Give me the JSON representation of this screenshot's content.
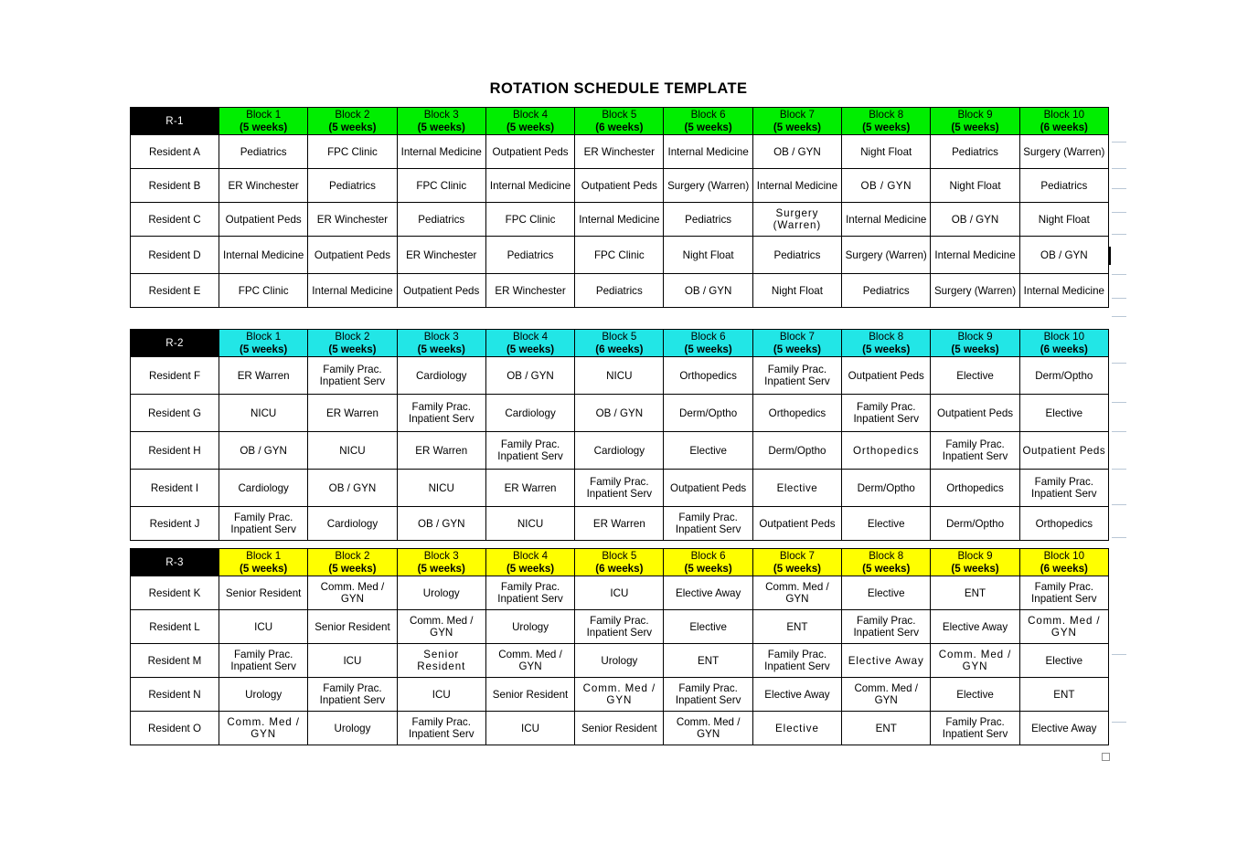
{
  "document": {
    "title": "ROTATION SCHEDULE TEMPLATE"
  },
  "blocks": {
    "headers": [
      {
        "name": "Block 1",
        "weeks": "(5 weeks)"
      },
      {
        "name": "Block 2",
        "weeks": "(5 weeks)"
      },
      {
        "name": "Block 3",
        "weeks": "(5 weeks)"
      },
      {
        "name": "Block 4",
        "weeks": "(5 weeks)"
      },
      {
        "name": "Block 5",
        "weeks": "(6 weeks)"
      },
      {
        "name": "Block 6",
        "weeks": "(5 weeks)"
      },
      {
        "name": "Block 7",
        "weeks": "(5 weeks)"
      },
      {
        "name": "Block 8",
        "weeks": "(5 weeks)"
      },
      {
        "name": "Block 9",
        "weeks": "(5 weeks)"
      },
      {
        "name": "Block 10",
        "weeks": "(6 weeks)"
      }
    ]
  },
  "colors": {
    "r1_header": "#00EE00",
    "r2_header": "#22E6E6",
    "r3_header": "#FFFF00",
    "year_cell": "#000000",
    "text": "#000000"
  },
  "r1": {
    "year_label": "R-1",
    "headers": [
      {
        "name": "Block 1",
        "weeks": "(5 weeks)"
      },
      {
        "name": "Block 2",
        "weeks": "(5 weeks)"
      },
      {
        "name": "Block 3",
        "weeks": "(5 weeks)"
      },
      {
        "name": "Block 4",
        "weeks": "(5 weeks)"
      },
      {
        "name": "Block 5",
        "weeks": "(6 weeks)"
      },
      {
        "name": "Block 6",
        "weeks": "(5 weeks)"
      },
      {
        "name": "Block 7",
        "weeks": "(5 weeks)"
      },
      {
        "name": "Block 8",
        "weeks": "(5 weeks)"
      },
      {
        "name": "Block 9",
        "weeks": "(5 weeks)"
      },
      {
        "name": "Block 10",
        "weeks": "(6 weeks)"
      }
    ],
    "rows": [
      {
        "resident": "Resident A",
        "cells": [
          "Pediatrics",
          "FPC Clinic",
          "Internal Medicine",
          "Outpatient Peds",
          "ER Winchester",
          "Internal Medicine",
          "OB / GYN",
          "Night Float",
          "Pediatrics",
          "Surgery (Warren)"
        ]
      },
      {
        "resident": "Resident B",
        "cells": [
          "ER Winchester",
          "Pediatrics",
          "FPC Clinic",
          "Internal Medicine",
          "Outpatient Peds",
          "Surgery (Warren)",
          "Internal Medicine",
          "OB / GYN",
          "Night Float",
          "Pediatrics"
        ]
      },
      {
        "resident": "Resident C",
        "cells": [
          "Outpatient Peds",
          "ER Winchester",
          "Pediatrics",
          "FPC Clinic",
          "Internal Medicine",
          "Pediatrics",
          "Surgery (Warren)",
          "Internal Medicine",
          "OB / GYN",
          "Night Float"
        ]
      },
      {
        "resident": "Resident D",
        "cells": [
          "Internal Medicine",
          "Outpatient Peds",
          "ER Winchester",
          "Pediatrics",
          "FPC Clinic",
          "Night Float",
          "Pediatrics",
          "Surgery (Warren)",
          "Internal Medicine",
          "OB / GYN"
        ]
      },
      {
        "resident": "Resident E",
        "cells": [
          "FPC Clinic",
          "Internal Medicine",
          "Outpatient Peds",
          "ER Winchester",
          "Pediatrics",
          "OB / GYN",
          "Night Float",
          "Pediatrics",
          "Surgery (Warren)",
          "Internal Medicine"
        ]
      }
    ]
  },
  "r2": {
    "year_label": "R-2",
    "headers": [
      {
        "name": "Block 1",
        "weeks": "(5 weeks)"
      },
      {
        "name": "Block 2",
        "weeks": "(5 weeks)"
      },
      {
        "name": "Block 3",
        "weeks": "(5 weeks)"
      },
      {
        "name": "Block 4",
        "weeks": "(5 weeks)"
      },
      {
        "name": "Block 5",
        "weeks": "(6 weeks)"
      },
      {
        "name": "Block 6",
        "weeks": "(5 weeks)"
      },
      {
        "name": "Block 7",
        "weeks": "(5 weeks)"
      },
      {
        "name": "Block 8",
        "weeks": "(5 weeks)"
      },
      {
        "name": "Block 9",
        "weeks": "(5 weeks)"
      },
      {
        "name": "Block 10",
        "weeks": "(6 weeks)"
      }
    ],
    "rows": [
      {
        "resident": "Resident F",
        "cells": [
          "ER  Warren",
          "Family Prac. Inpatient Serv",
          "Cardiology",
          "OB / GYN",
          "NICU",
          "Orthopedics",
          "Family Prac. Inpatient Serv",
          "Outpatient Peds",
          "Elective",
          "Derm/Optho"
        ]
      },
      {
        "resident": "Resident G",
        "cells": [
          "NICU",
          "ER Warren",
          "Family Prac. Inpatient Serv",
          "Cardiology",
          "OB / GYN",
          "Derm/Optho",
          "Orthopedics",
          "Family Prac. Inpatient Serv",
          "Outpatient Peds",
          "Elective"
        ]
      },
      {
        "resident": "Resident H",
        "cells": [
          "OB / GYN",
          "NICU",
          "ER Warren",
          "Family Prac. Inpatient Serv",
          "Cardiology",
          "Elective",
          "Derm/Optho",
          "Orthopedics",
          "Family Prac. Inpatient Serv",
          "Outpatient Peds"
        ]
      },
      {
        "resident": "Resident I",
        "cells": [
          "Cardiology",
          "OB / GYN",
          "NICU",
          "ER  Warren",
          "Family Prac. Inpatient Serv",
          "Outpatient Peds",
          "Elective",
          "Derm/Optho",
          "Orthopedics",
          "Family Prac. Inpatient Serv"
        ]
      },
      {
        "resident": "Resident J",
        "cells": [
          "Family Prac. Inpatient Serv",
          "Cardiology",
          "OB / GYN",
          "NICU",
          "ER  Warren",
          "Family Prac. Inpatient Serv",
          "Outpatient Peds",
          "Elective",
          "Derm/Optho",
          "Orthopedics"
        ]
      }
    ]
  },
  "r3": {
    "year_label": "R-3",
    "headers": [
      {
        "name": "Block 1",
        "weeks": "(5 weeks)"
      },
      {
        "name": "Block 2",
        "weeks": "(5 weeks)"
      },
      {
        "name": "Block 3",
        "weeks": "(5 weeks)"
      },
      {
        "name": "Block 4",
        "weeks": "(5 weeks)"
      },
      {
        "name": "Block 5",
        "weeks": "(6 weeks)"
      },
      {
        "name": "Block 6",
        "weeks": "(5 weeks)"
      },
      {
        "name": "Block 7",
        "weeks": "(5 weeks)"
      },
      {
        "name": "Block 8",
        "weeks": "(5 weeks)"
      },
      {
        "name": "Block 9",
        "weeks": "(5 weeks)"
      },
      {
        "name": "Block 10",
        "weeks": "(6 weeks)"
      }
    ],
    "rows": [
      {
        "resident": "Resident K",
        "cells": [
          "Senior Resident",
          "Comm. Med / GYN",
          "Urology",
          "Family Prac. Inpatient Serv",
          "ICU",
          "Elective Away",
          "Comm. Med / GYN",
          "Elective",
          "ENT",
          "Family Prac. Inpatient Serv"
        ]
      },
      {
        "resident": "Resident L",
        "cells": [
          "ICU",
          "Senior Resident",
          "Comm. Med / GYN",
          "Urology",
          "Family Prac. Inpatient Serv",
          "Elective",
          "ENT",
          "Family Prac. Inpatient Serv",
          "Elective Away",
          "Comm. Med / GYN"
        ]
      },
      {
        "resident": "Resident M",
        "cells": [
          "Family Prac. Inpatient Serv",
          "ICU",
          "Senior Resident",
          "Comm. Med / GYN",
          "Urology",
          "ENT",
          "Family Prac. Inpatient Serv",
          "Elective  Away",
          "Comm. Med / GYN",
          "Elective"
        ]
      },
      {
        "resident": "Resident N",
        "cells": [
          "Urology",
          "Family Prac. Inpatient Serv",
          "ICU",
          "Senior Resident",
          "Comm. Med / GYN",
          "Family Prac. Inpatient Serv",
          "Elective Away",
          "Comm. Med / GYN",
          "Elective",
          "ENT"
        ]
      },
      {
        "resident": "Resident O",
        "cells": [
          "Comm. Med / GYN",
          "Urology",
          "Family Prac. Inpatient Serv",
          "ICU",
          "Senior Resident",
          "Comm. Med / GYN",
          "Elective",
          "ENT",
          "Family Prac. Inpatient Serv",
          "Elective Away"
        ]
      }
    ]
  }
}
